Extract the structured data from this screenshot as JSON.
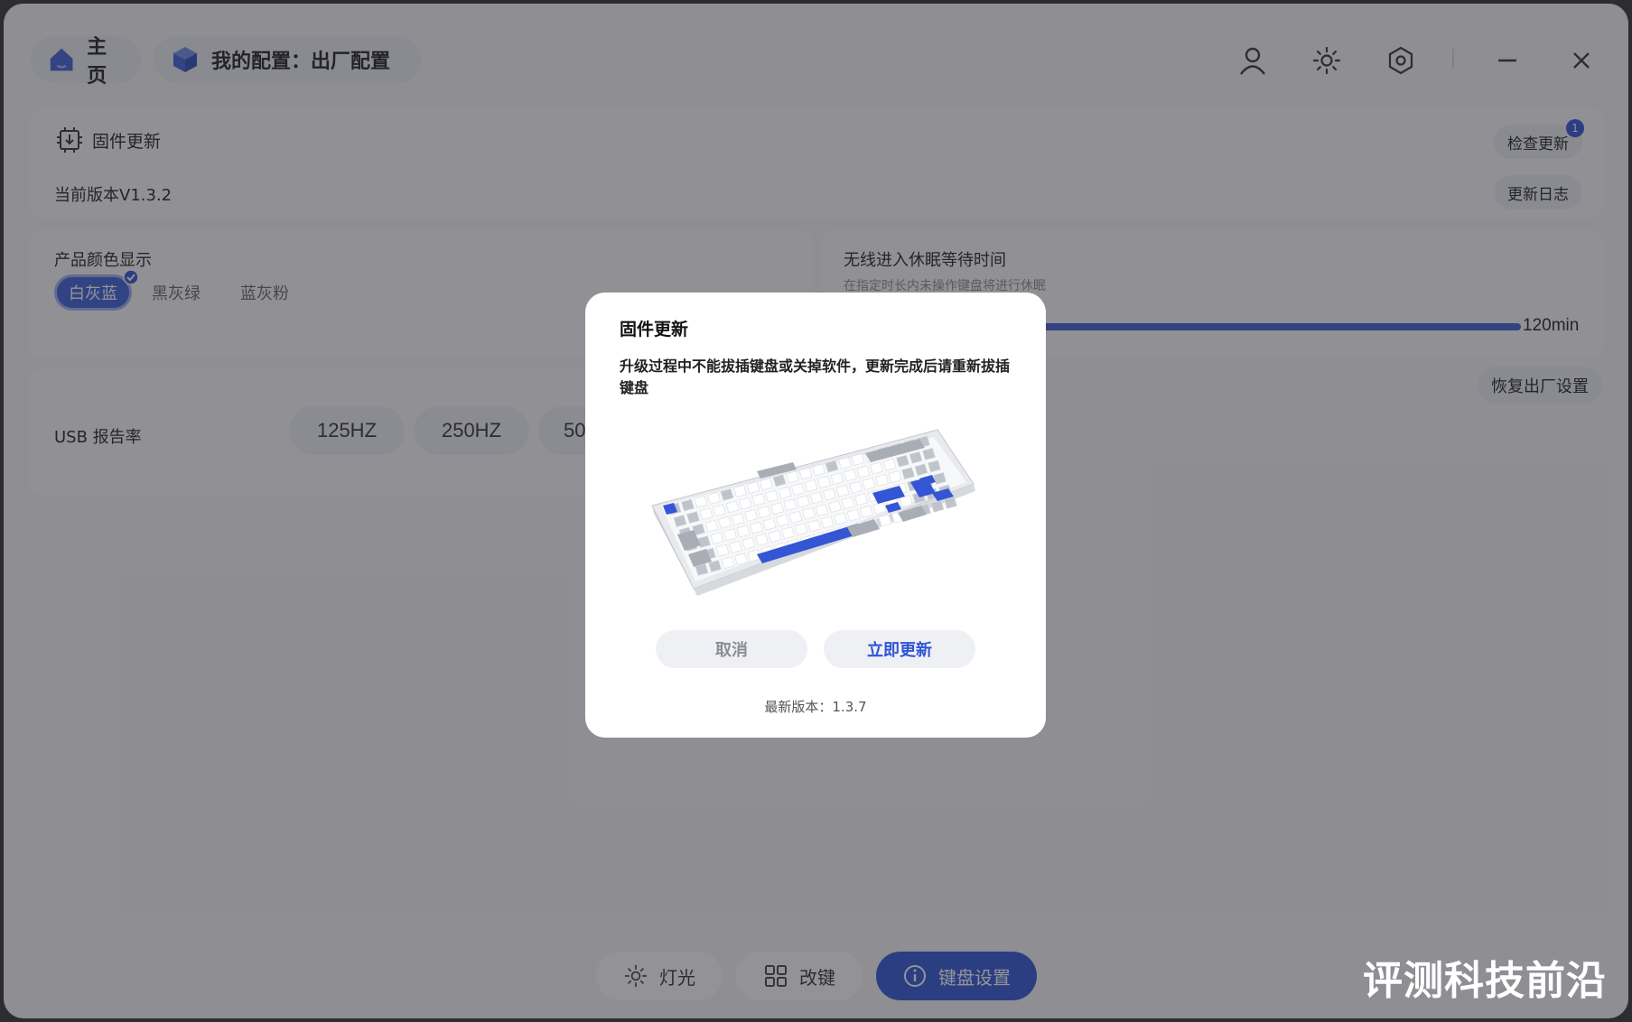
{
  "header": {
    "home_label": "主页",
    "config_label": "我的配置：出厂配置"
  },
  "firmware": {
    "title": "固件更新",
    "current_version": "当前版本V1.3.2",
    "check_update": "检查更新",
    "badge_count": "1",
    "changelog": "更新日志"
  },
  "color_display": {
    "title": "产品颜色显示",
    "options": [
      "白灰蓝",
      "黑灰绿",
      "蓝灰粉"
    ],
    "selected": "白灰蓝"
  },
  "sleep": {
    "title": "无线进入休眠等待时间",
    "desc": "在指定时长内未操作键盘将进行休眠",
    "value": "120min",
    "slider_fraction": 1.0
  },
  "reset": {
    "label": "恢复出厂设置"
  },
  "usb": {
    "title": "USB 报告率",
    "options": [
      "125HZ",
      "250HZ",
      "50"
    ]
  },
  "bottom_nav": {
    "lighting": "灯光",
    "remap": "改键",
    "keyboard_settings": "键盘设置",
    "active": "键盘设置"
  },
  "modal": {
    "title": "固件更新",
    "message": "升级过程中不能拔插键盘或关掉软件，更新完成后请重新拔插键盘",
    "cancel": "取消",
    "update_now": "立即更新",
    "latest_version": "最新版本：1.3.7"
  },
  "watermark": "评测科技前沿",
  "colors": {
    "accent": "#2f54d6",
    "overlay": "#5a5a5f",
    "keycap_blue": "#3556d4",
    "keycap_grey": "#a9adb5"
  }
}
